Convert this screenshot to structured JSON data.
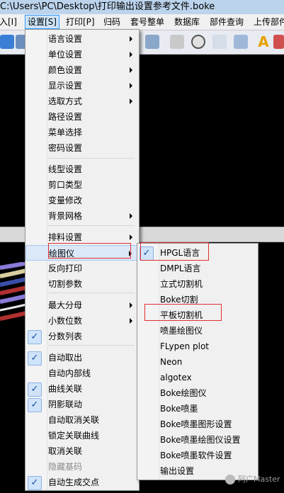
{
  "window": {
    "title": "C:\\Users\\PC\\Desktop\\打印输出设置参考文件.boke"
  },
  "menubar": {
    "items": [
      "入[I]",
      "设置[S]",
      "打印[P]",
      "归码",
      "套号整单",
      "数据库",
      "部件查询",
      "上传部件"
    ]
  },
  "settings_menu": {
    "items": [
      {
        "label": "语言设置",
        "submenu": true
      },
      {
        "label": "单位设置",
        "submenu": true
      },
      {
        "label": "颜色设置",
        "submenu": true
      },
      {
        "label": "显示设置",
        "submenu": true
      },
      {
        "label": "选取方式",
        "submenu": true
      },
      {
        "label": "路径设置"
      },
      {
        "label": "菜单选择"
      },
      {
        "label": "密码设置"
      },
      {
        "label": "线型设置"
      },
      {
        "label": "剪口类型"
      },
      {
        "label": "变量修改"
      },
      {
        "label": "背景网格",
        "submenu": true
      },
      {
        "label": "排料设置",
        "submenu": true
      },
      {
        "label": "绘图仪",
        "submenu": true,
        "highlighted": true
      },
      {
        "label": "反向打印"
      },
      {
        "label": "切割参数"
      },
      {
        "label": "最大分母",
        "submenu": true
      },
      {
        "label": "小数位数",
        "submenu": true
      },
      {
        "label": "分数列表",
        "checked": true
      },
      {
        "label": "自动取出",
        "checked": true
      },
      {
        "label": "自动内部线"
      },
      {
        "label": "曲线关联",
        "checked": true
      },
      {
        "label": "阴影联动",
        "checked": true
      },
      {
        "label": "自动取消关联"
      },
      {
        "label": "锁定关联曲线"
      },
      {
        "label": "取消关联"
      },
      {
        "label": "隐藏基码",
        "disabled": true
      },
      {
        "label": "自动生成交点",
        "checked": true
      }
    ]
  },
  "plotter_menu": {
    "items": [
      {
        "label": "HPGL语言",
        "checked": true
      },
      {
        "label": "DMPL语言"
      },
      {
        "label": "立式切割机"
      },
      {
        "label": "Boke切割"
      },
      {
        "label": "平板切割机"
      },
      {
        "label": "喷墨绘图仪"
      },
      {
        "label": "FLypen plot"
      },
      {
        "label": "Neon"
      },
      {
        "label": "algotex"
      },
      {
        "label": "Boke绘图仪"
      },
      {
        "label": "Boke喷墨"
      },
      {
        "label": "Boke喷墨图形设置"
      },
      {
        "label": "Boke喷墨绘图仪设置"
      },
      {
        "label": "Boke喷墨软件设置"
      },
      {
        "label": "输出设置"
      }
    ]
  },
  "watermark": "阿广Master",
  "icons": {
    "check": "✓",
    "toolbar": [
      "refresh-icon",
      "arrow-icon",
      "select-icon",
      "cut-icon",
      "export-icon",
      "save-icon",
      "circle-icon",
      "notepad-icon",
      "tools-icon",
      "text-a-icon",
      "flag-icon"
    ]
  }
}
